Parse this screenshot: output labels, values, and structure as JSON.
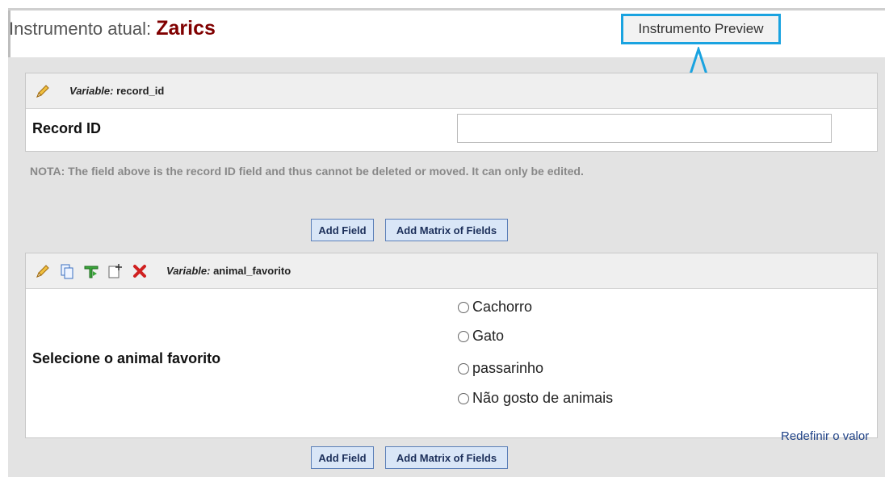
{
  "header": {
    "title_prefix": "Instrumento atual:",
    "instrument_name": "Zarics",
    "preview_button": "Instrumento Preview"
  },
  "record_field": {
    "variable_prefix": "Variable:",
    "variable_name": "record_id",
    "label": "Record ID",
    "input_value": ""
  },
  "note": "NOTA: The field above is the record ID field and thus cannot be deleted or moved. It can only be edited.",
  "add_buttons": {
    "add_field": "Add Field",
    "add_matrix": "Add Matrix of Fields"
  },
  "animal_field": {
    "variable_prefix": "Variable:",
    "variable_name": "animal_favorito",
    "label": "Selecione o animal favorito",
    "options": [
      "Cachorro",
      "Gato",
      "passarinho",
      "Não gosto de animais"
    ],
    "reset_link": "Redefinir o valor"
  },
  "colors": {
    "highlight": "#1aa3e0",
    "instrument_name": "#800000"
  },
  "icons": [
    "pencil-icon",
    "copy-icon",
    "branching-icon",
    "move-icon",
    "delete-icon"
  ]
}
